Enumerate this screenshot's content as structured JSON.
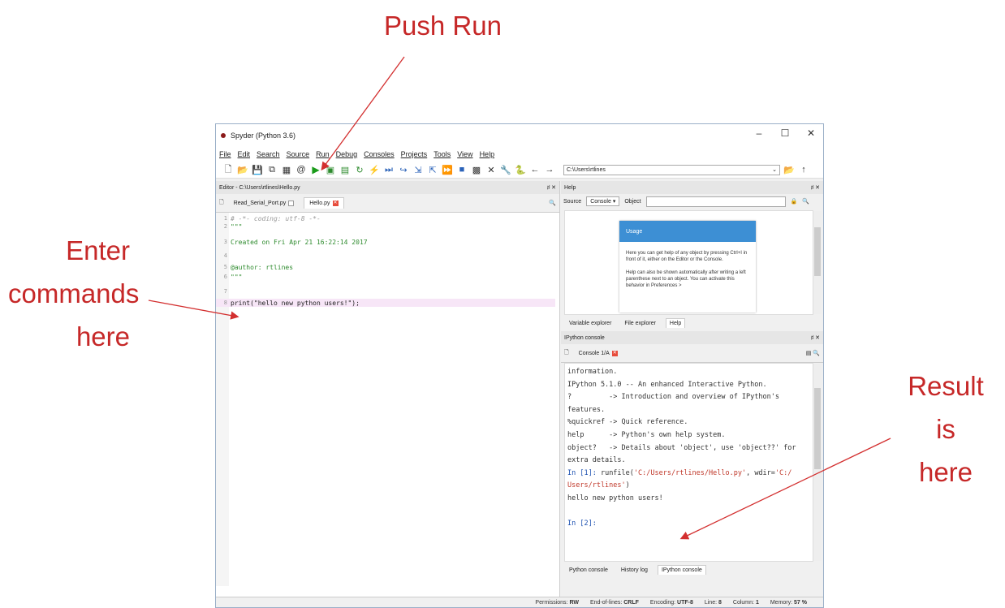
{
  "annotations": {
    "run": "Push Run",
    "enter": "Enter\ncommands\nhere",
    "result": "Result is\nhere"
  },
  "window": {
    "title": "Spyder (Python 3.6)",
    "controls": [
      "–",
      "☐",
      "✕"
    ]
  },
  "menu": [
    "File",
    "Edit",
    "Search",
    "Source",
    "Run",
    "Debug",
    "Consoles",
    "Projects",
    "Tools",
    "View",
    "Help"
  ],
  "toolbar": {
    "path": "C:\\Users\\rtlines"
  },
  "editor": {
    "header": "Editor - C:\\Users\\rtlines\\Hello.py",
    "header_controls": "♯ ✕",
    "tabs": [
      {
        "label": "Read_Serial_Port.py"
      },
      {
        "label": "Hello.py"
      }
    ],
    "lines": [
      {
        "num": "1",
        "text": "# -*- coding: utf-8 -*-"
      },
      {
        "num": "2",
        "text": "\"\"\""
      },
      {
        "num": "3",
        "text": "Created on Fri Apr 21 16:22:14 2017"
      },
      {
        "num": "4",
        "text": ""
      },
      {
        "num": "5",
        "text": "@author: rtlines"
      },
      {
        "num": "6",
        "text": "\"\"\""
      },
      {
        "num": "7",
        "text": ""
      },
      {
        "num": "8",
        "text": "print(\"hello new python users!\");"
      }
    ]
  },
  "help": {
    "header": "Help",
    "header_controls": "♯ ✕",
    "source_label": "Source",
    "source_value": "Console",
    "object_label": "Object",
    "card_title": "Usage",
    "card_text1": "Here you can get help of any object by pressing Ctrl+I in front of it, either on the Editor or the Console.",
    "card_text2": "Help can also be shown automatically after writing a left parenthese next to an object. You can activate this behavior in Preferences >",
    "tabs": [
      "Variable explorer",
      "File explorer",
      "Help"
    ]
  },
  "console": {
    "header": "IPython console",
    "header_controls": "♯ ✕",
    "tab": "Console 1/A",
    "lines": [
      "information.",
      "",
      "IPython 5.1.0 -- An enhanced Interactive Python.",
      "?         -> Introduction and overview of IPython's",
      "features.",
      "%quickref -> Quick reference.",
      "help      -> Python's own help system.",
      "object?   -> Details about 'object', use 'object??' for",
      "extra details.",
      ""
    ],
    "in1_prompt": "In [1]: ",
    "in1_cmd": "runfile(",
    "in1_path1": "'C:/Users/rtlines/Hello.py'",
    "in1_mid": ", wdir=",
    "in1_path2a": "'C:/",
    "in1_path2b": "Users/rtlines'",
    "in1_end": ")",
    "output": "hello new python users!",
    "in2_prompt": "In [2]:",
    "tabs": [
      "Python console",
      "History log",
      "IPython console"
    ]
  },
  "status": {
    "permissions_label": "Permissions:",
    "permissions": "RW",
    "eol_label": "End-of-lines:",
    "eol": "CRLF",
    "encoding_label": "Encoding:",
    "encoding": "UTF-8",
    "line_label": "Line:",
    "line": "8",
    "column_label": "Column:",
    "column": "1",
    "memory_label": "Memory:",
    "memory": "57 %"
  }
}
